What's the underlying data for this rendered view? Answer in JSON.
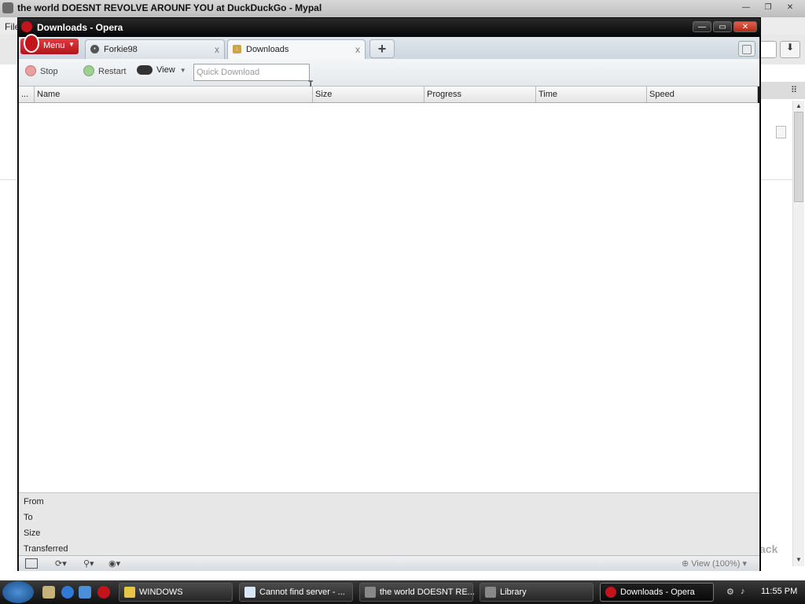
{
  "background_window": {
    "title": "the world DOESNT REVOLVE AROUNF YOU at DuckDuckGo - Mypal",
    "menu_first": "File",
    "back_text": "ack"
  },
  "opera": {
    "title": "Downloads - Opera",
    "menu_label": "Menu",
    "tabs": [
      {
        "label": "Forkie98",
        "close": "x"
      },
      {
        "label": "Downloads",
        "close": "x"
      }
    ],
    "new_tab": "+",
    "toolbar": {
      "stop": "Stop",
      "restart": "Restart",
      "view": "View",
      "quick_download_placeholder": "Quick Download"
    },
    "columns": [
      "...",
      "Name",
      "Size",
      "Progress",
      "Time",
      "Speed"
    ],
    "details": [
      "From",
      "To",
      "Size",
      "Transferred"
    ],
    "zoom_label": "View (100%)"
  },
  "taskbar": {
    "items": [
      {
        "label": "WINDOWS",
        "icon": "folder-icon",
        "color": "#e8c547"
      },
      {
        "label": "Cannot find server - ...",
        "icon": "ie-page-icon",
        "color": "#d9e6f5"
      },
      {
        "label": "the world DOESNT RE...",
        "icon": "mypal-icon",
        "color": "#888888"
      },
      {
        "label": "Library",
        "icon": "mypal-icon",
        "color": "#888888"
      },
      {
        "label": "Downloads - Opera",
        "icon": "opera-icon",
        "color": "#c3141c"
      }
    ],
    "clock": "11:55 PM"
  },
  "colors": {
    "opera_red": "#c3141c",
    "title_bar": "#050505",
    "tabbar": "#cdd6de"
  }
}
